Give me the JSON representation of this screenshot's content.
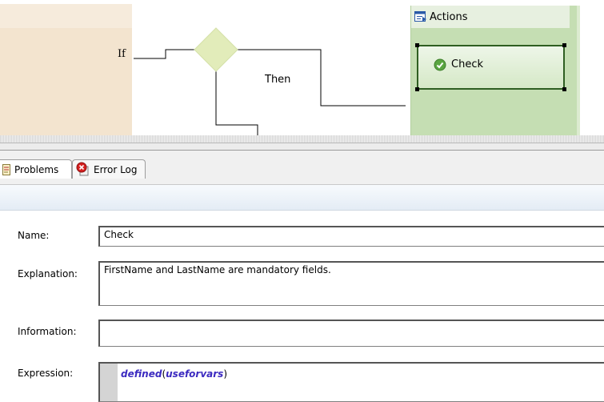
{
  "diagram": {
    "if_label": "If",
    "then_label": "Then",
    "actions": {
      "title": "Actions",
      "icon": "actions-icon",
      "items": [
        {
          "label": "Check",
          "icon": "check-icon",
          "selected": true
        }
      ]
    }
  },
  "tabs": [
    {
      "label": "Problems",
      "icon": "problems-icon",
      "active": true
    },
    {
      "label": "Error Log",
      "icon": "error-log-icon",
      "active": false
    }
  ],
  "properties": {
    "name": {
      "label": "Name:",
      "value": "Check"
    },
    "explanation": {
      "label": "Explanation:",
      "value": "FirstName and LastName are mandatory fields."
    },
    "information": {
      "label": "Information:",
      "value": ""
    },
    "expression": {
      "label": "Expression:",
      "func": "defined",
      "open": "(",
      "arg": "useforvars",
      "close": ")"
    }
  },
  "colors": {
    "if_panel": "#f3e4cf",
    "actions_panel": "#c5deb3",
    "diamond": "#e2ecba",
    "selection_border": "#2f5e22",
    "keyword": "#3b2ac0"
  }
}
